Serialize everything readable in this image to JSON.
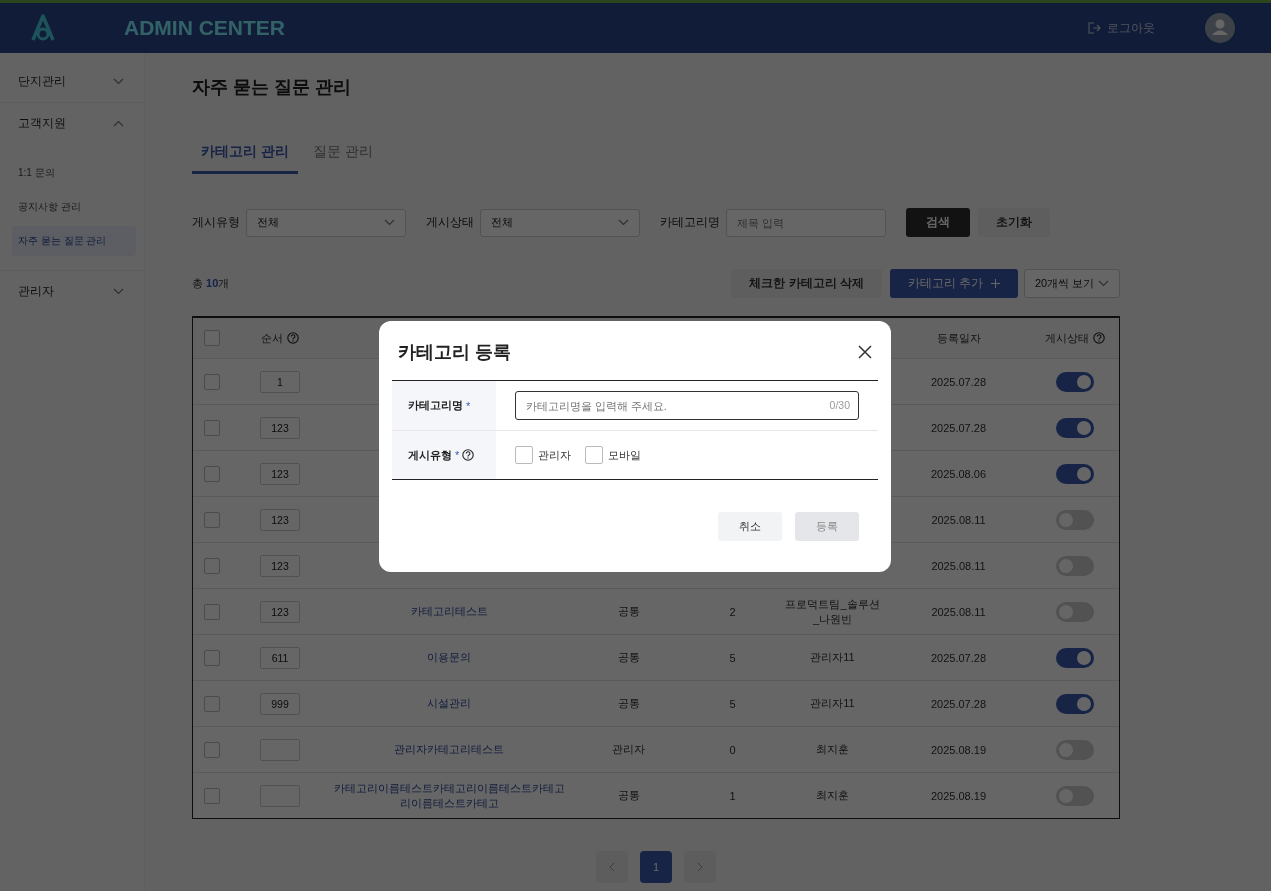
{
  "header": {
    "logo": "ADMIN CENTER",
    "logout": "로그아웃"
  },
  "sidebar": {
    "items": [
      {
        "label": "단지관리",
        "expanded": false
      },
      {
        "label": "고객지원",
        "expanded": true,
        "children": [
          {
            "label": "1:1 문의",
            "selected": false
          },
          {
            "label": "공지사항 관리",
            "selected": false
          },
          {
            "label": "자주 묻는 질문 관리",
            "selected": true
          }
        ]
      },
      {
        "label": "관리자",
        "expanded": false
      }
    ]
  },
  "page_title": "자주 묻는 질문 관리",
  "tabs": [
    {
      "label": "카테고리 관리",
      "selected": true
    },
    {
      "label": "질문 관리",
      "selected": false
    }
  ],
  "filters": [
    {
      "kind": "select",
      "label": "게시유형",
      "value": "전체"
    },
    {
      "kind": "select",
      "label": "게시상태",
      "value": "전체"
    },
    {
      "kind": "text",
      "label": "카테고리명",
      "placeholder": "제목 입력"
    }
  ],
  "search_button": "검색",
  "reset_button": "초기화",
  "total": "총 **10**개",
  "delete_button": "체크한 카테고리 삭제",
  "add_button": "카테고리 추가",
  "page_size": "20개씩 보기",
  "table": {
    "all_checked": false,
    "header": {
      "order": {
        "label": "순서",
        "help": true
      },
      "date": {
        "label": "등록일자",
        "help": false
      },
      "status": {
        "label": "게시상태",
        "help": true
      }
    },
    "rows": [
      {
        "checked": false,
        "order": "1",
        "date": "2025.07.28",
        "on": true
      },
      {
        "checked": false,
        "order": "123",
        "date": "2025.07.28",
        "on": true
      },
      {
        "checked": false,
        "order": "123",
        "date": "2025.08.06",
        "on": true
      },
      {
        "checked": false,
        "order": "123",
        "date": "2025.08.11",
        "on": false
      },
      {
        "checked": false,
        "order": "123",
        "date": "2025.08.11",
        "on": false
      },
      {
        "checked": false,
        "order": "123",
        "name": "카테고리테스트",
        "type": "공통",
        "count": "2",
        "author": "프로덕트팀_솔루션_나원빈",
        "date": "2025.08.11",
        "on": false
      },
      {
        "checked": false,
        "order": "611",
        "name": "이용문의",
        "type": "공통",
        "count": "5",
        "author": "관리자11",
        "date": "2025.07.28",
        "on": true
      },
      {
        "checked": false,
        "order": "999",
        "name": "시설관리",
        "type": "공통",
        "count": "5",
        "author": "관리자11",
        "date": "2025.07.28",
        "on": true
      },
      {
        "checked": false,
        "name": "관리자카테고리테스트",
        "type": "관리자",
        "count": "0",
        "author": "최지훈",
        "date": "2025.08.19",
        "on": false
      },
      {
        "checked": false,
        "name": "카테고리이름테스트카테고리이름테스트카테고리이름테스트카테고",
        "type": "공통",
        "count": "1",
        "author": "최지훈",
        "date": "2025.08.19",
        "on": false
      }
    ]
  },
  "pagination": {
    "pages": [
      {
        "label": "1",
        "selected": true
      }
    ]
  },
  "modal": {
    "title": "카테고리 등록",
    "fields": [
      {
        "kind": "text",
        "label": "카테고리명",
        "required_mark": "*",
        "help": false,
        "placeholder": "카테고리명을 입력해 주세요.",
        "counter": "0/30"
      },
      {
        "kind": "checks",
        "label": "게시유형",
        "required_mark": "*",
        "help": true,
        "options": [
          {
            "label": "관리자",
            "checked": false
          },
          {
            "label": "모바일",
            "checked": false
          }
        ]
      }
    ],
    "cancel_button": "취소",
    "submit_button": {
      "label": "등록",
      "disabled": true
    }
  }
}
